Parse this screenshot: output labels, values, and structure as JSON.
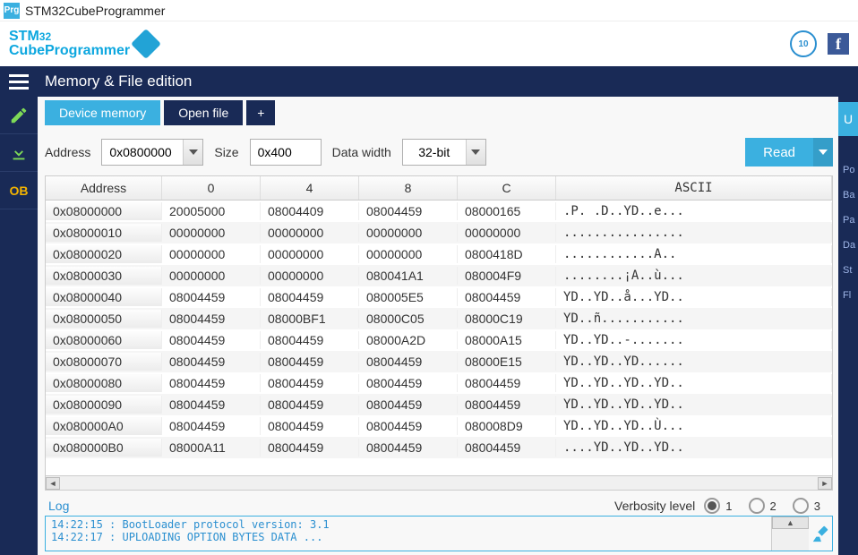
{
  "window": {
    "title": "STM32CubeProgrammer"
  },
  "brand": {
    "line1": "STM",
    "s32": "32",
    "line2": "CubeProgrammer",
    "badge": "10"
  },
  "section": {
    "title": "Memory & File edition"
  },
  "sidebar": {
    "ob": "OB"
  },
  "tabs": {
    "device": "Device memory",
    "openfile": "Open file",
    "plus": "+"
  },
  "controls": {
    "address_label": "Address",
    "address_value": "0x0800000",
    "size_label": "Size",
    "size_value": "0x400",
    "datawidth_label": "Data width",
    "datawidth_value": "32-bit",
    "read_label": "Read"
  },
  "grid": {
    "headers": {
      "addr": "Address",
      "c0": "0",
      "c4": "4",
      "c8": "8",
      "cc": "C",
      "ascii": "ASCII"
    },
    "rows": [
      {
        "addr": "0x08000000",
        "v": [
          "20005000",
          "08004409",
          "08004459",
          "08000165"
        ],
        "ascii": ".P. .D..YD..e..."
      },
      {
        "addr": "0x08000010",
        "v": [
          "00000000",
          "00000000",
          "00000000",
          "00000000"
        ],
        "ascii": "................"
      },
      {
        "addr": "0x08000020",
        "v": [
          "00000000",
          "00000000",
          "00000000",
          "0800418D"
        ],
        "ascii": "............A.."
      },
      {
        "addr": "0x08000030",
        "v": [
          "00000000",
          "00000000",
          "080041A1",
          "080004F9"
        ],
        "ascii": "........¡A..ù..."
      },
      {
        "addr": "0x08000040",
        "v": [
          "08004459",
          "08004459",
          "080005E5",
          "08004459"
        ],
        "ascii": "YD..YD..å...YD.."
      },
      {
        "addr": "0x08000050",
        "v": [
          "08004459",
          "08000BF1",
          "08000C05",
          "08000C19"
        ],
        "ascii": "YD..ñ..........."
      },
      {
        "addr": "0x08000060",
        "v": [
          "08004459",
          "08004459",
          "08000A2D",
          "08000A15"
        ],
        "ascii": "YD..YD..-......."
      },
      {
        "addr": "0x08000070",
        "v": [
          "08004459",
          "08004459",
          "08004459",
          "08000E15"
        ],
        "ascii": "YD..YD..YD......"
      },
      {
        "addr": "0x08000080",
        "v": [
          "08004459",
          "08004459",
          "08004459",
          "08004459"
        ],
        "ascii": "YD..YD..YD..YD.."
      },
      {
        "addr": "0x08000090",
        "v": [
          "08004459",
          "08004459",
          "08004459",
          "08004459"
        ],
        "ascii": "YD..YD..YD..YD.."
      },
      {
        "addr": "0x080000A0",
        "v": [
          "08004459",
          "08004459",
          "08004459",
          "080008D9"
        ],
        "ascii": "YD..YD..YD..Ù..."
      },
      {
        "addr": "0x080000B0",
        "v": [
          "08000A11",
          "08004459",
          "08004459",
          "08004459"
        ],
        "ascii": "....YD..YD..YD.."
      }
    ]
  },
  "log": {
    "label": "Log",
    "verbosity_label": "Verbosity level",
    "levels": [
      "1",
      "2",
      "3"
    ],
    "selected_level": "1",
    "lines": "14:22:15 : BootLoader protocol version: 3.1\n14:22:17 : UPLOADING OPTION BYTES DATA ...\n"
  },
  "rightpanel": {
    "tab": "U",
    "labels": [
      "Po",
      "Ba",
      "Pa",
      "Da",
      "St",
      "Fl"
    ]
  }
}
